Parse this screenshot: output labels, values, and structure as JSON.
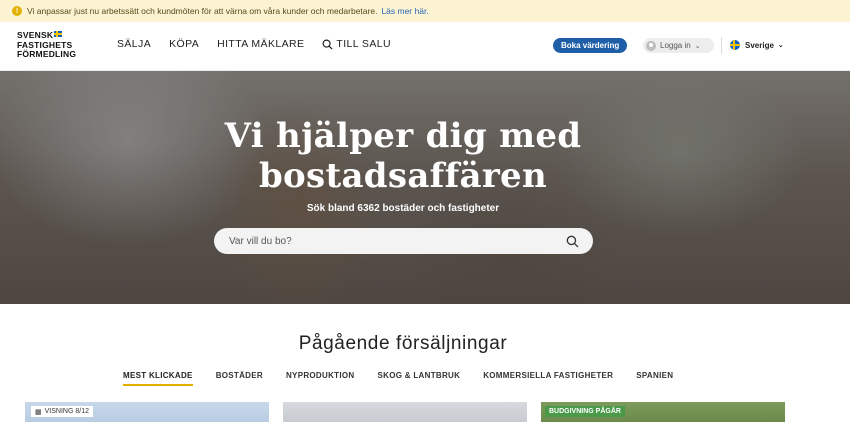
{
  "notice": {
    "text": "Vi anpassar just nu arbetssätt och kundmöten för att värna om våra kunder och medarbetare.",
    "link": "Läs mer här.",
    "icon": "info-icon"
  },
  "header": {
    "logo_line1": "SVENSK",
    "logo_line2": "FASTIGHETS",
    "logo_line3": "FÖRMEDLING",
    "nav": [
      "SÄLJA",
      "KÖPA",
      "HITTA MÄKLARE",
      "TILL SALU"
    ],
    "book_button": "Boka värdering",
    "login": "Logga in",
    "country": "Sverige"
  },
  "hero": {
    "title_line1": "Vi hjälper dig med",
    "title_line2": "bostadsaffären",
    "subtitle": "Sök bland 6362 bostäder och fastigheter",
    "search_placeholder": "Var vill du bo?"
  },
  "listings": {
    "title": "Pågående försäljningar",
    "tabs": [
      "MEST KLICKADE",
      "BOSTÄDER",
      "NYPRODUKTION",
      "SKOG & LANTBRUK",
      "KOMMERSIELLA FASTIGHETER",
      "SPANIEN"
    ],
    "active_tab": "MEST KLICKADE",
    "card1_badge": "VISNING 8/12",
    "card3_badge": "BUDGIVNING PÅGÅR"
  },
  "colors": {
    "accent_yellow": "#e2b100",
    "primary_blue": "#1f5fa8",
    "notice_bg": "#fbf3d2",
    "badge_green": "#4a9a4a"
  }
}
